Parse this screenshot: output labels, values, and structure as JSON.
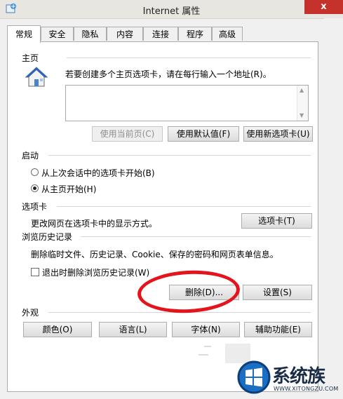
{
  "window": {
    "title": "Internet 属性",
    "close_label": "x"
  },
  "tabs": [
    {
      "label": "常规",
      "active": true
    },
    {
      "label": "安全"
    },
    {
      "label": "隐私"
    },
    {
      "label": "内容"
    },
    {
      "label": "连接"
    },
    {
      "label": "程序"
    },
    {
      "label": "高级"
    }
  ],
  "homepage": {
    "section_title": "主页",
    "description": "若要创建多个主页选项卡，请在每行输入一个地址(R)。",
    "value": "",
    "buttons": {
      "use_current": "使用当前页(C)",
      "use_default": "使用默认值(F)",
      "use_new_tab": "使用新选项卡(U)"
    }
  },
  "startup": {
    "section_title": "启动",
    "option_last_session": "从上次会话中的选项卡开始(B)",
    "option_home_page": "从主页开始(H)",
    "selected": "home_page"
  },
  "tabs_section": {
    "section_title": "选项卡",
    "description": "更改网页在选项卡中的显示方式。",
    "button": "选项卡(T)"
  },
  "history": {
    "section_title": "浏览历史记录",
    "description": "删除临时文件、历史记录、Cookie、保存的密码和网页表单信息。",
    "checkbox_label": "退出时删除浏览历史记录(W)",
    "checkbox_checked": false,
    "delete_button": "删除(D)...",
    "settings_button": "设置(S)"
  },
  "appearance": {
    "section_title": "外观",
    "colors": "颜色(O)",
    "languages": "语言(L)",
    "fonts": "字体(N)",
    "accessibility": "辅助功能(E)"
  },
  "watermark": {
    "name": "系统族",
    "url": "WWW.XITONGZU.COM"
  },
  "colors": {
    "highlight_circle": "#e5141c",
    "close_button": "#c4322b"
  }
}
